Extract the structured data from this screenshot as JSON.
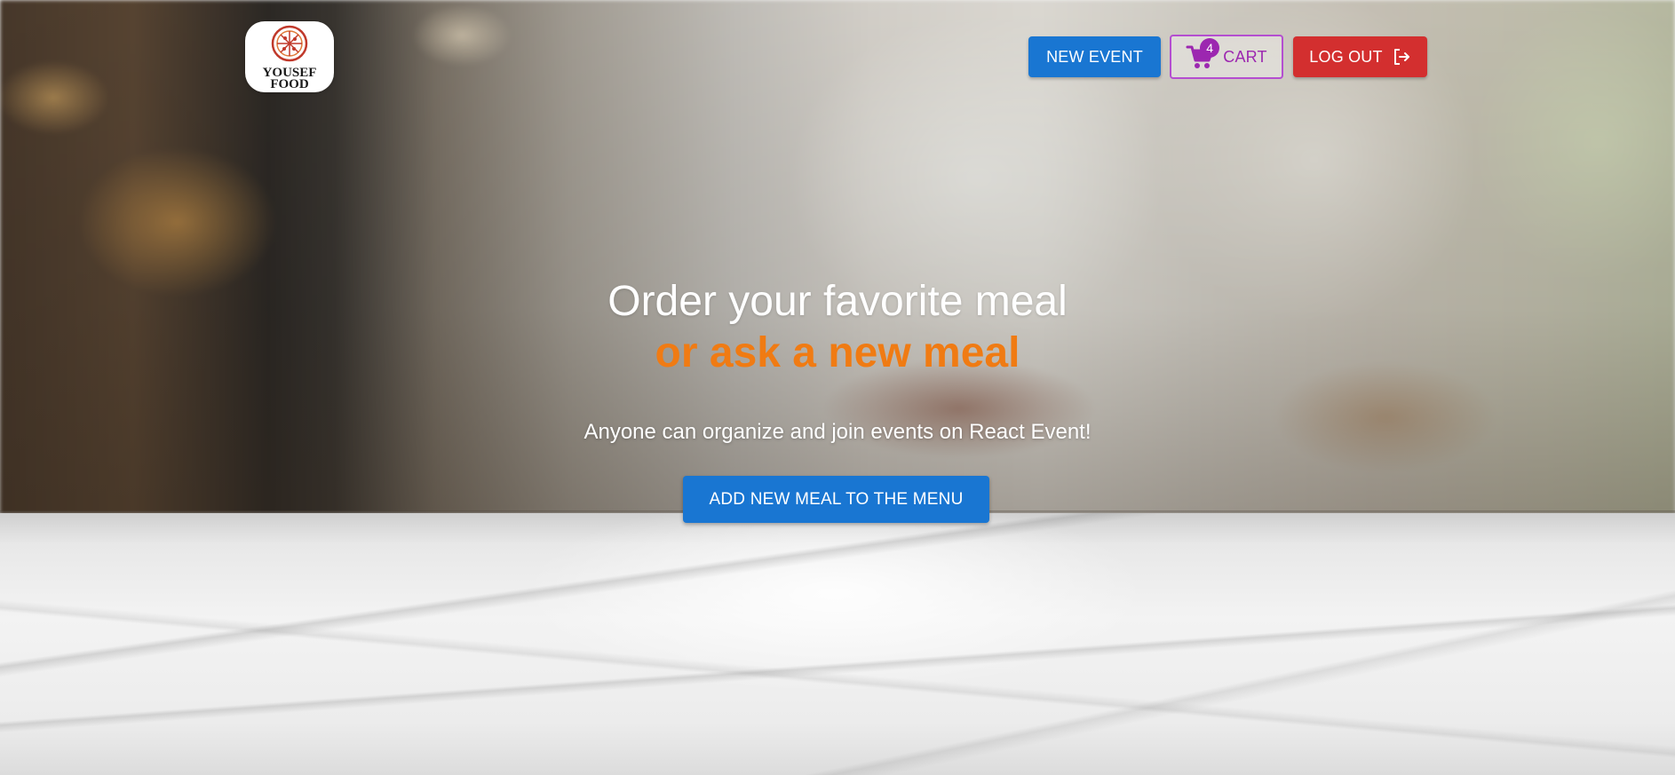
{
  "header": {
    "logo": {
      "line1": "YOUSEF",
      "line2": "FOOD",
      "icon": "pizza-icon"
    },
    "new_event_label": "NEW EVENT",
    "cart": {
      "label": "CART",
      "count": "4",
      "icon": "shopping-cart-icon"
    },
    "logout": {
      "label": "LOG OUT",
      "icon": "logout-icon"
    }
  },
  "hero": {
    "title_line1": "Order your favorite meal",
    "title_line2": "or ask a new meal",
    "subtitle": "Anyone can organize and join events on React Event!",
    "cta_label": "ADD NEW MEAL TO THE MENU"
  },
  "colors": {
    "primary": "#1976d2",
    "secondary": "#9c27b0",
    "error": "#d32f2f",
    "accent_text": "#f07b13"
  }
}
